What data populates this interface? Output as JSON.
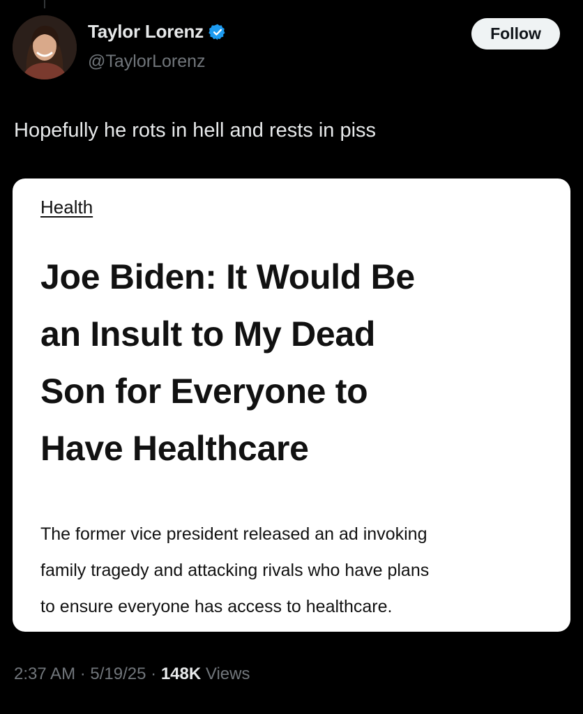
{
  "author": {
    "display_name": "Taylor Lorenz",
    "handle": "@TaylorLorenz",
    "verified_icon": "verified-badge-icon",
    "avatar_icon": "profile-photo-avatar"
  },
  "follow_label": "Follow",
  "tweet_text": "Hopefully he rots in hell and rests in piss",
  "card": {
    "category": "Health",
    "headline_lines": [
      "Joe Biden: It Would Be",
      "an Insult to My Dead",
      "Son for Everyone to",
      "Have Healthcare"
    ],
    "dek_lines": [
      "The former vice president released an ad invoking",
      "family tragedy and attacking rivals who have plans",
      "to ensure everyone has access to healthcare."
    ]
  },
  "meta": {
    "time": "2:37 AM",
    "separator": "·",
    "date": "5/19/25",
    "views_count": "148K",
    "views_label": "Views"
  },
  "colors": {
    "background": "#000000",
    "primary_text": "#e7e9ea",
    "secondary_text": "#71767b",
    "verified_blue": "#1d9bf0",
    "follow_bg": "#eff3f4",
    "card_bg": "#ffffff"
  }
}
